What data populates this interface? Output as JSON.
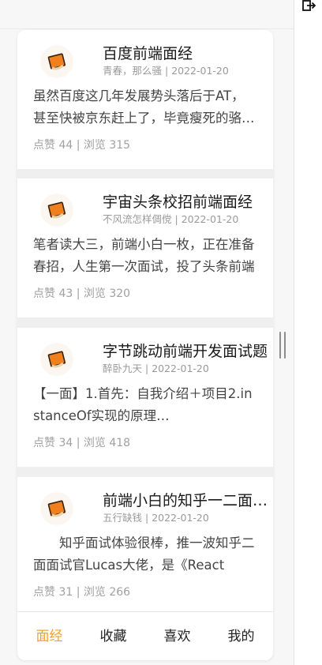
{
  "articles": [
    {
      "title": "百度前端面经",
      "author": "青春，那么骚",
      "date": "2022-01-20",
      "excerpt": "虽然百度这几年发展势头落后于AT，甚至快被京东赶上了，毕竟瘦死的骆驼比马大",
      "likes_label": "点赞",
      "likes": "44",
      "views_label": "浏览",
      "views": "315"
    },
    {
      "title": "宇宙头条校招前端面经",
      "author": "不风流怎样倜傥",
      "date": "2022-01-20",
      "excerpt": "笔者读大三，前端小白一枚，正在准备春招，人生第一次面试，投了头条前端",
      "likes_label": "点赞",
      "likes": "43",
      "views_label": "浏览",
      "views": "320"
    },
    {
      "title": "字节跳动前端开发面试题",
      "author": "醉卧九天",
      "date": "2022-01-20",
      "excerpt": "【一面】1.首先：自我介绍＋项目2.instanceOf实现的原理…",
      "likes_label": "点赞",
      "likes": "34",
      "views_label": "浏览",
      "views": "418"
    },
    {
      "title": "前端小白的知乎一二面面经",
      "author": "五行缺钱",
      "date": "2022-01-20",
      "excerpt": "　　知乎面试体验很棒，推一波知乎二面面试官Lucas大佬，是《React",
      "likes_label": "点赞",
      "likes": "31",
      "views_label": "浏览",
      "views": "266"
    }
  ],
  "tabs": [
    {
      "label": "面经",
      "active": true
    },
    {
      "label": "收藏",
      "active": false
    },
    {
      "label": "喜欢",
      "active": false
    },
    {
      "label": "我的",
      "active": false
    }
  ],
  "colors": {
    "accent": "#f0a030",
    "logo_orange": "#f07f1e"
  },
  "icons": {
    "card_logo": "orange-book-icon",
    "top_right": "exit-icon",
    "scroll": "scroll-grip-icon"
  }
}
